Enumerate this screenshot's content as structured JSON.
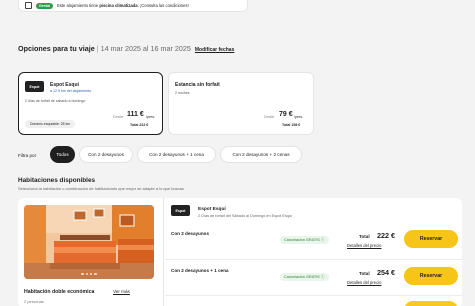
{
  "notice": {
    "badge": "Genial",
    "text_prefix": "Este alojamiento tiene ",
    "text_bold": "piscina climatizada",
    "text_suffix": ". ¡Consulta las condiciones!"
  },
  "trip": {
    "title": "Opciones para tu viaje",
    "separator": "|",
    "dates": "14 mar 2025 al 16 mar 2025",
    "modify": "Modificar fechas"
  },
  "options": [
    {
      "logo": "Espot",
      "name": "Espot Esquí",
      "link": "a 12.9 km del alojamiento",
      "sub": "2 días de forfait de sábado a domingo",
      "pill": "Dominio esquiable: 25 km",
      "from": "Desde",
      "price": "111 €",
      "per": "/pers.",
      "total": "Total 222 €",
      "selected": true
    },
    {
      "name": "Estancia sin forfait",
      "sub": "2 noches",
      "from": "Desde",
      "price": "79 €",
      "per": "/pers.",
      "total": "Total 158 €",
      "selected": false
    }
  ],
  "filters": {
    "label": "Filtra por",
    "chips": [
      "Todos",
      "Con 2 desayunos",
      "Con 2 desayunos + 1 cena",
      "Con 2 desayunos + 2 cenas"
    ]
  },
  "rooms": {
    "title": "Habitaciones disponibles",
    "subtitle": "Selecciona la habitación o combinación de habitaciones que mejor se adapte a lo que buscas"
  },
  "room": {
    "name": "Habitación doble económica",
    "more": "Ver más",
    "occupancy": "2 personas",
    "pack_logo": "Espot",
    "pack_name": "Espot Esquí",
    "pack_sub": "2 Días de forfait del Sábado al Domingo en Espot Esquí",
    "offers": [
      {
        "label": "Con 2 desayunos",
        "cancel": "Cancelación GRATIS ⓘ",
        "total_label": "Total",
        "total": "222 €",
        "details": "Detalles del precio",
        "button": "Reservar"
      },
      {
        "label": "Con 2 desayunos + 1 cena",
        "cancel": "Cancelación GRATIS ⓘ",
        "total_label": "Total",
        "total": "254 €",
        "details": "Detalles del precio",
        "button": "Reservar"
      }
    ]
  },
  "colors": {
    "accent_yellow": "#f7c418",
    "badge_green": "#2e9d4a",
    "text_dark": "#1f1f1f",
    "background": "#f3f3f3"
  }
}
